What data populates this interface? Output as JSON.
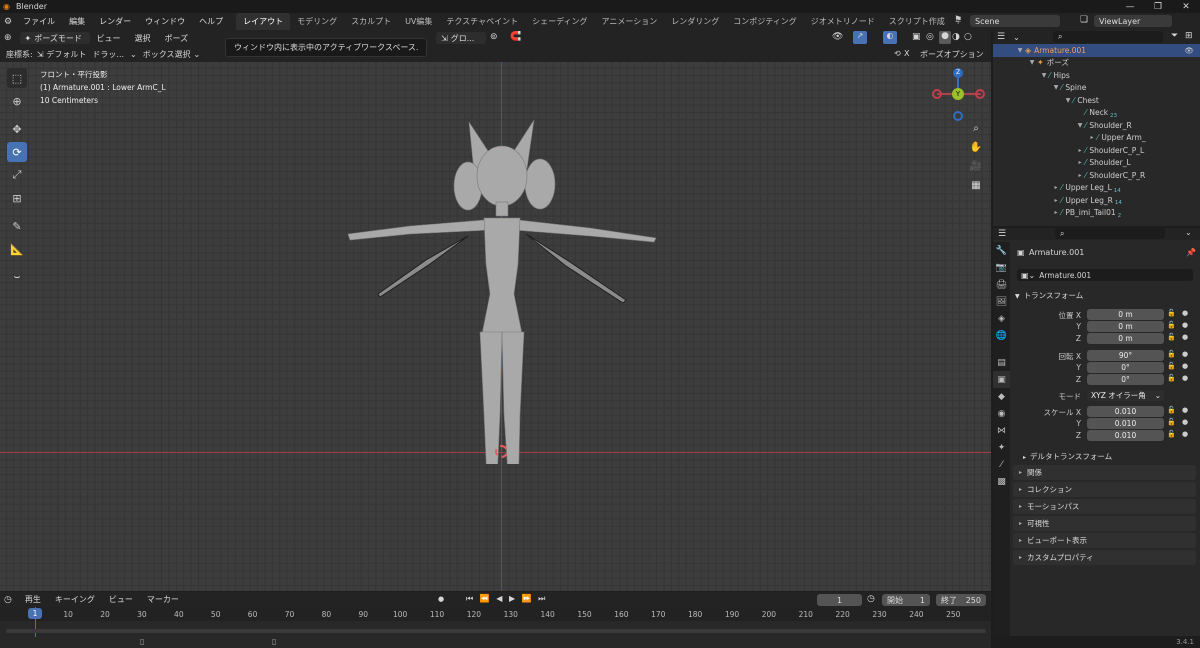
{
  "window": {
    "title": "Blender",
    "controls": [
      "—",
      "❐",
      "✕"
    ]
  },
  "menu": {
    "items": [
      "ファイル",
      "編集",
      "レンダー",
      "ウィンドウ",
      "ヘルプ"
    ],
    "workspaces": [
      "レイアウト",
      "モデリング",
      "スカルプト",
      "UV編集",
      "テクスチャペイント",
      "シェーディング",
      "アニメーション",
      "レンダリング",
      "コンポジティング",
      "ジオメトリノード",
      "スクリプト作成"
    ],
    "active_workspace": "レイアウト",
    "scene": "Scene",
    "view_layer": "ViewLayer"
  },
  "viewport_header": {
    "mode": "ポーズモード",
    "view": "ビュー",
    "select": "選択",
    "pose": "ポーズ",
    "orientation": "グロ...",
    "pose_options": "ポーズオプション"
  },
  "viewport_header2": {
    "coord_label": "座標系:",
    "coord_value": "デフォルト",
    "drag_label": "ドラッ...",
    "select_box": "ボックス選択"
  },
  "tooltip": "ウィンドウ内に表示中のアクティブワークスペース.",
  "overlay_text": {
    "line1": "フロント・平行投影",
    "line2": "(1) Armature.001 : Lower ArmC_L",
    "line3": "10 Centimeters"
  },
  "gizmo": {
    "z": "Z",
    "y": "Y",
    "x": "X"
  },
  "outliner": {
    "rows": [
      {
        "label": "Armature.001",
        "indent": 0,
        "arrow": "▼",
        "type": "obj",
        "selected": true
      },
      {
        "label": "ポーズ",
        "indent": 1,
        "arrow": "▼",
        "type": "pose"
      },
      {
        "label": "Hips",
        "indent": 2,
        "arrow": "▼",
        "type": "bone"
      },
      {
        "label": "Spine",
        "indent": 3,
        "arrow": "▼",
        "type": "bone"
      },
      {
        "label": "Chest",
        "indent": 4,
        "arrow": "▼",
        "type": "bone"
      },
      {
        "label": "Neck",
        "indent": 5,
        "arrow": "",
        "type": "bone",
        "sub": "23"
      },
      {
        "label": "Shoulder_R",
        "indent": 5,
        "arrow": "▼",
        "type": "bone"
      },
      {
        "label": "Upper Arm_",
        "indent": 6,
        "arrow": "▸",
        "type": "bone"
      },
      {
        "label": "ShoulderC_P_L",
        "indent": 5,
        "arrow": "▸",
        "type": "bone"
      },
      {
        "label": "Shoulder_L",
        "indent": 5,
        "arrow": "▸",
        "type": "bone"
      },
      {
        "label": "ShoulderC_P_R",
        "indent": 5,
        "arrow": "▸",
        "type": "bone"
      },
      {
        "label": "Upper Leg_L",
        "indent": 3,
        "arrow": "▸",
        "type": "bone",
        "sub": "14"
      },
      {
        "label": "Upper Leg_R",
        "indent": 3,
        "arrow": "▸",
        "type": "bone",
        "sub": "14"
      },
      {
        "label": "PB_imi_Tail01",
        "indent": 3,
        "arrow": "▸",
        "type": "bone",
        "sub": "2"
      }
    ]
  },
  "properties": {
    "object_name": "Armature.001",
    "data_name": "Armature.001",
    "transform_title": "トランスフォーム",
    "location_label": "位置 X",
    "rotation_label": "回転 X",
    "scale_label": "スケール X",
    "y_label": "Y",
    "z_label": "Z",
    "location": [
      "0 m",
      "0 m",
      "0 m"
    ],
    "rotation": [
      "90°",
      "0°",
      "0°"
    ],
    "mode_label": "モード",
    "mode_value": "XYZ オイラー角",
    "scale": [
      "0.010",
      "0.010",
      "0.010"
    ],
    "delta": "デルタトランスフォーム",
    "panels": [
      "関係",
      "コレクション",
      "モーションパス",
      "可視性",
      "ビューポート表示",
      "カスタムプロパティ"
    ]
  },
  "timeline": {
    "playback": "再生",
    "keying": "キーイング",
    "view": "ビュー",
    "marker": "マーカー",
    "current": "1",
    "start_label": "開始",
    "start": "1",
    "end_label": "終了",
    "end": "250",
    "ticks": [
      "1",
      "10",
      "20",
      "30",
      "40",
      "50",
      "60",
      "70",
      "80",
      "90",
      "100",
      "110",
      "120",
      "130",
      "140",
      "150",
      "160",
      "170",
      "180",
      "190",
      "200",
      "210",
      "220",
      "230",
      "240",
      "250"
    ]
  },
  "status": {
    "version": "3.4.1"
  }
}
